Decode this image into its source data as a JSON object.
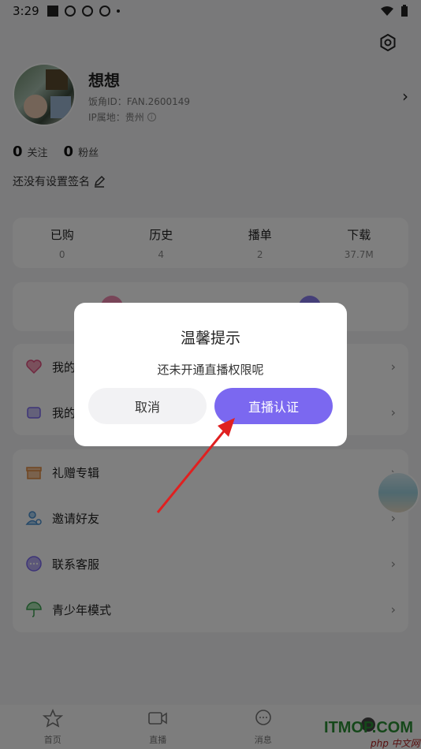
{
  "status_bar": {
    "time": "3:29"
  },
  "profile": {
    "username": "想想",
    "fan_id": "饭角ID：FAN.2600149",
    "ip_location": "IP属地：贵州"
  },
  "stats": {
    "following_count": "0",
    "following_label": "关注",
    "fans_count": "0",
    "fans_label": "粉丝"
  },
  "signature": "还没有设置签名",
  "summary": [
    {
      "title": "已购",
      "value": "0"
    },
    {
      "title": "历史",
      "value": "4"
    },
    {
      "title": "播单",
      "value": "2"
    },
    {
      "title": "下载",
      "value": "37.7M"
    }
  ],
  "menu1": [
    {
      "label": "我的"
    },
    {
      "label": "我的"
    }
  ],
  "menu2": [
    {
      "label": "礼赠专辑",
      "icon": "gift-icon"
    },
    {
      "label": "邀请好友",
      "icon": "invite-user-icon"
    },
    {
      "label": "联系客服",
      "icon": "chat-support-icon"
    },
    {
      "label": "青少年模式",
      "icon": "umbrella-icon"
    }
  ],
  "bottom_nav": [
    {
      "label": "首页"
    },
    {
      "label": "直播"
    },
    {
      "label": "消息"
    }
  ],
  "dialog": {
    "title": "温馨提示",
    "message": "还未开通直播权限呢",
    "cancel_label": "取消",
    "confirm_label": "直播认证"
  },
  "watermark": {
    "text": "ITMOP.COM",
    "php": "php 中文网"
  },
  "colors": {
    "accent": "#7b68f0",
    "arrow": "#e02020",
    "background": "#f2f2f4"
  }
}
